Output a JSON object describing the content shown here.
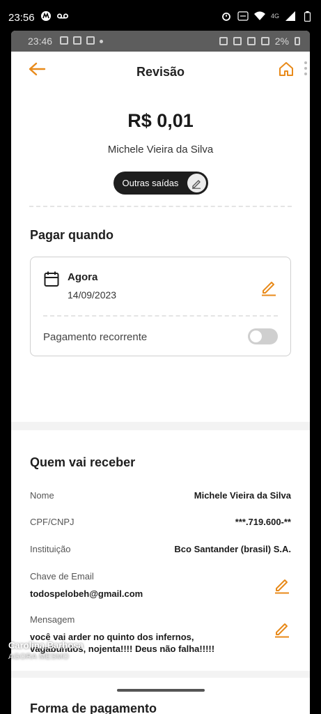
{
  "outer_status": {
    "time": "23:56",
    "network": "4G"
  },
  "inner_status": {
    "time": "23:46",
    "battery": "2%"
  },
  "header": {
    "title": "Revisão",
    "back_icon": "arrow-left-icon",
    "home_icon": "home-icon"
  },
  "summary": {
    "amount": "R$ 0,01",
    "payee": "Michele Vieira da Silva",
    "category": "Outras saídas"
  },
  "pay_when": {
    "title": "Pagar quando",
    "when_label": "Agora",
    "date": "14/09/2023",
    "recurring_label": "Pagamento recorrente",
    "recurring_on": false
  },
  "receiver": {
    "title": "Quem vai receber",
    "name_label": "Nome",
    "name_value": "Michele Vieira da Silva",
    "doc_label": "CPF/CNPJ",
    "doc_value": "***.719.600-**",
    "institution_label": "Instituição",
    "institution_value": "Bco Santander (brasil) S.A.",
    "key_label": "Chave de Email",
    "key_value": "todospelobeh@gmail.com",
    "message_label": "Mensagem",
    "message_value_line1": "você vai arder no quinto dos infernos,",
    "message_value_line2": "vagabundos, nojenta!!!! Deus não falha!!!!!"
  },
  "payment": {
    "title": "Forma de pagamento"
  },
  "overlay": {
    "name": "Carolina Barbosa",
    "time": "AGORA MESMO"
  },
  "colors": {
    "accent": "#E88A1A",
    "chip": "#1E1E1E"
  }
}
